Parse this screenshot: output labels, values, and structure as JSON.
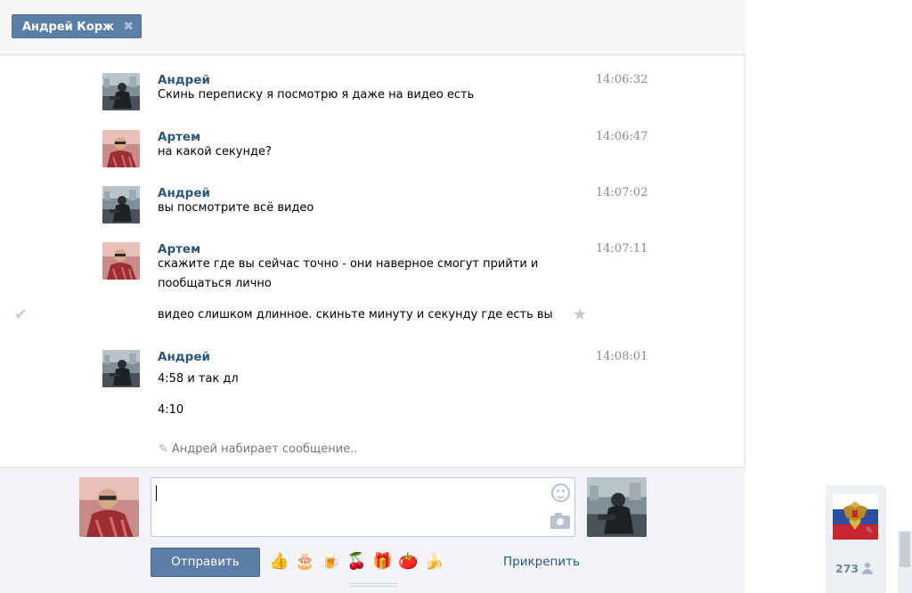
{
  "chat": {
    "tab_label": "Андрей Корж",
    "tab_close": "✖"
  },
  "messages": [
    {
      "author": "Андрей",
      "time": "14:06:32",
      "lines": [
        "Скинь переписку я посмотрю я даже на видео есть"
      ]
    },
    {
      "author": "Артем",
      "time": "14:06:47",
      "lines": [
        "на какой секунде?"
      ]
    },
    {
      "author": "Андрей",
      "time": "14:07:02",
      "lines": [
        "вы посмотрите всё видео"
      ]
    },
    {
      "author": "Артем",
      "time": "14:07:11",
      "lines": [
        "скажите где вы сейчас точно - они наверное смогут прийти и",
        "пообщаться лично",
        "видео слишком длинное. скиньте минуту и секунду где есть вы"
      ]
    },
    {
      "author": "Андрей",
      "time": "14:08:01",
      "lines": [
        "4:58 и так дл",
        "4:10"
      ]
    }
  ],
  "icons": {
    "check": "✔",
    "star": "★",
    "pencil": "✎",
    "edit": "✎"
  },
  "typing": {
    "text": "Андрей набирает сообщение.."
  },
  "composer": {
    "send_label": "Отправить",
    "attach_label": "Прикрепить",
    "input_value": "",
    "emoji": [
      "👍",
      "🎂",
      "🍺",
      "🍒",
      "🎁",
      "🍅",
      "🍌"
    ]
  },
  "sidebar": {
    "friend_count": "273"
  },
  "colors": {
    "accent": "#5b7fa6",
    "author": "#2b587a",
    "time": "#8a8a8a"
  }
}
